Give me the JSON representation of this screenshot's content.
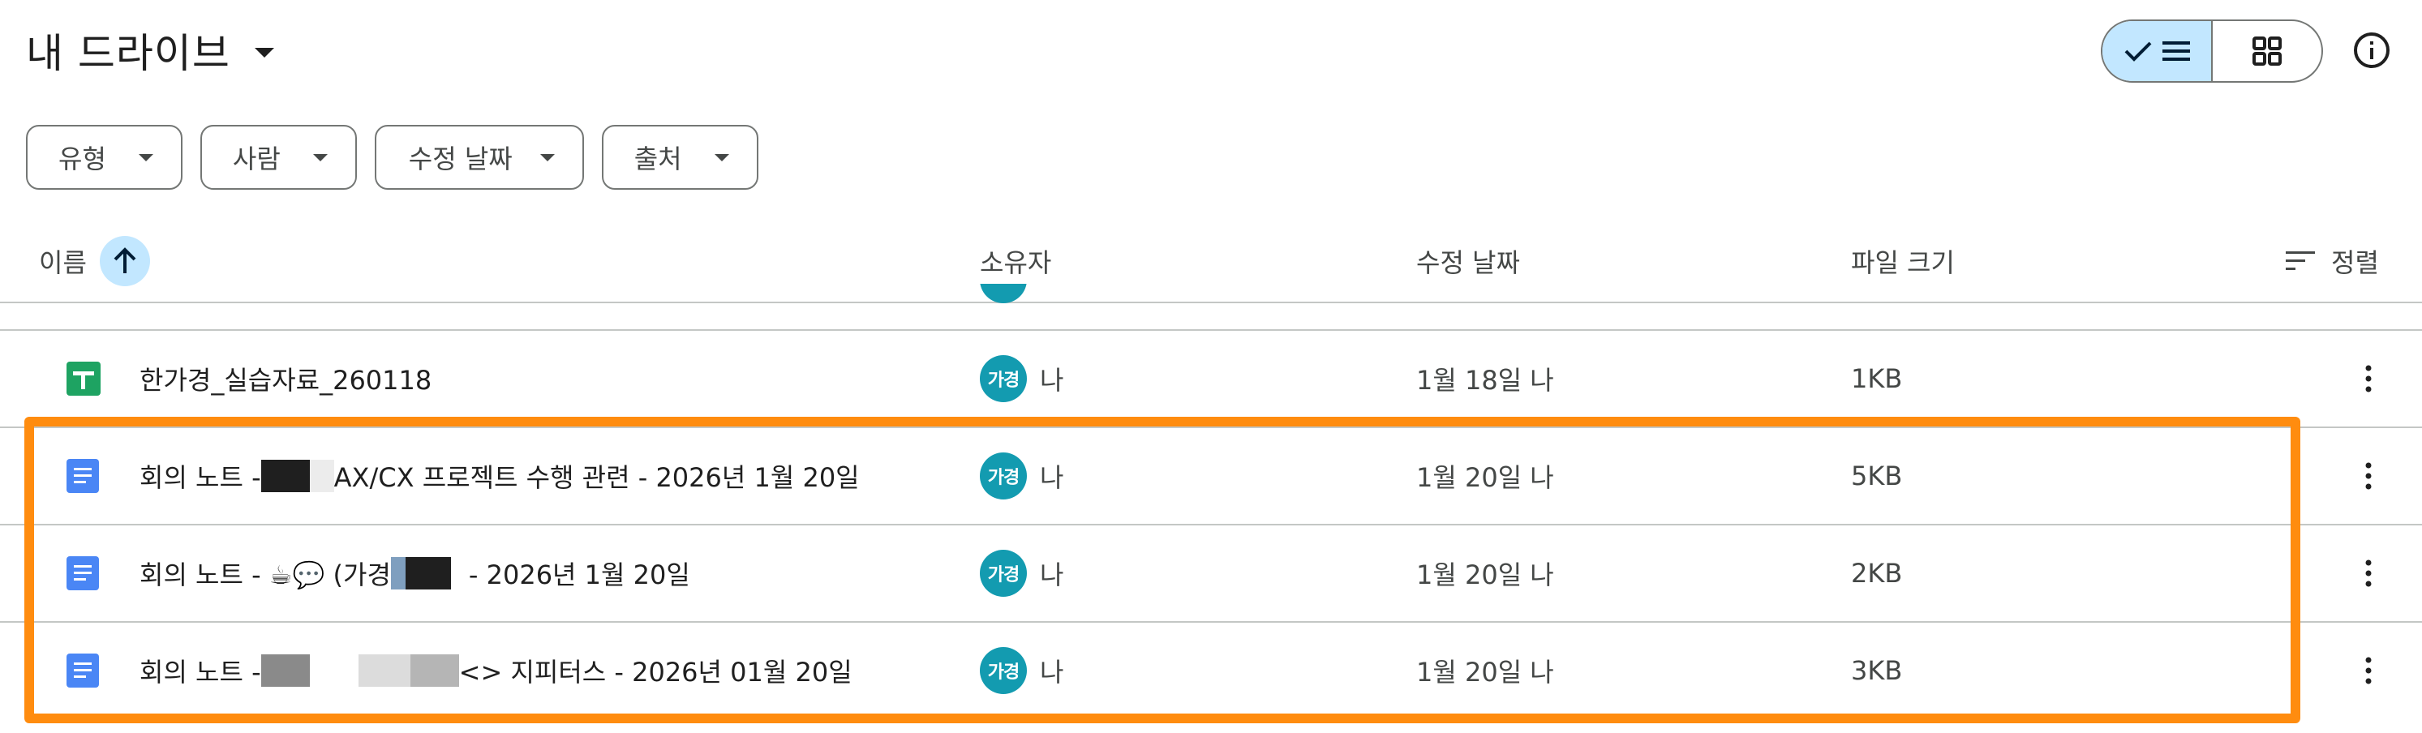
{
  "header": {
    "title": "내 드라이브",
    "view_toggle": {
      "list_icon": "check-list-icon",
      "grid_icon": "grid-icon"
    },
    "info_icon": "info-icon"
  },
  "filters": [
    {
      "label": "유형"
    },
    {
      "label": "사람"
    },
    {
      "label": "수정 날짜"
    },
    {
      "label": "출처"
    }
  ],
  "columns": {
    "name": "이름",
    "owner": "소유자",
    "modified": "수정 날짜",
    "size": "파일 크기",
    "sort": "정렬"
  },
  "rows": [
    {
      "type": "sheets",
      "name_parts": [
        "한가경_실습자료_260118"
      ],
      "owner_avatar": "가경",
      "owner": "나",
      "modified": "1월 18일 나",
      "size": "1KB"
    },
    {
      "type": "docs",
      "name_parts": [
        "회의 노트 - ",
        " AX/CX 프로젝트 수행 관련 - 2026년 1월 20일"
      ],
      "owner_avatar": "가경",
      "owner": "나",
      "modified": "1월 20일 나",
      "size": "5KB"
    },
    {
      "type": "docs",
      "name_parts": [
        "회의 노트 - ☕💬 (가경",
        " - 2026년 1월 20일"
      ],
      "owner_avatar": "가경",
      "owner": "나",
      "modified": "1월 20일 나",
      "size": "2KB"
    },
    {
      "type": "docs",
      "name_parts": [
        "회의 노트 - ",
        " <> 지피터스 - 2026년 01월 20일"
      ],
      "owner_avatar": "가경",
      "owner": "나",
      "modified": "1월 20일 나",
      "size": "3KB"
    }
  ],
  "colors": {
    "highlight": "#ff8c0f",
    "avatar": "#139bb0",
    "accent": "#c2e7ff"
  }
}
